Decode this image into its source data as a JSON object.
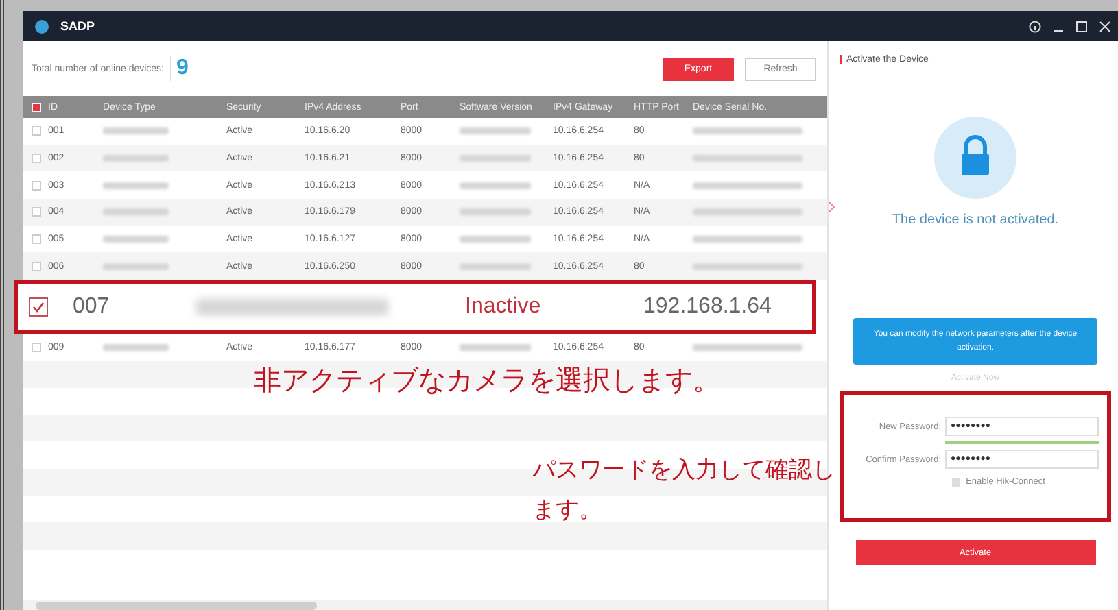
{
  "window": {
    "title": "SADP"
  },
  "summary": {
    "label": "Total number of online devices:",
    "count": "9"
  },
  "buttons": [
    {
      "label": "Export",
      "kind": "primary"
    },
    {
      "label": "Refresh",
      "kind": "secondary"
    }
  ],
  "table": {
    "header_checked": true,
    "columns": [
      "ID",
      "Device Type",
      "Security",
      "IPv4 Address",
      "Port",
      "Software Version",
      "IPv4 Gateway",
      "HTTP Port",
      "Device Serial No."
    ],
    "rows": [
      {
        "id": "001",
        "security": "Active",
        "ipv4": "10.16.6.20",
        "port": "8000",
        "gateway": "10.16.6.254",
        "http_port": "80",
        "checked": false
      },
      {
        "id": "002",
        "security": "Active",
        "ipv4": "10.16.6.21",
        "port": "8000",
        "gateway": "10.16.6.254",
        "http_port": "80",
        "checked": false
      },
      {
        "id": "003",
        "security": "Active",
        "ipv4": "10.16.6.213",
        "port": "8000",
        "gateway": "10.16.6.254",
        "http_port": "N/A",
        "checked": false
      },
      {
        "id": "004",
        "security": "Active",
        "ipv4": "10.16.6.179",
        "port": "8000",
        "gateway": "10.16.6.254",
        "http_port": "N/A",
        "checked": false
      },
      {
        "id": "005",
        "security": "Active",
        "ipv4": "10.16.6.127",
        "port": "8000",
        "gateway": "10.16.6.254",
        "http_port": "N/A",
        "checked": false
      },
      {
        "id": "006",
        "security": "Active",
        "ipv4": "10.16.6.250",
        "port": "8000",
        "gateway": "10.16.6.254",
        "http_port": "80",
        "checked": false
      }
    ],
    "rows_below": [
      {
        "id": "009",
        "security": "Active",
        "ipv4": "10.16.6.177",
        "port": "8000",
        "gateway": "10.16.6.254",
        "http_port": "80",
        "checked": false
      }
    ]
  },
  "highlight_row": {
    "id": "007",
    "security": "Inactive",
    "address": "192.168.1.64",
    "checked": true
  },
  "annotations": [
    {
      "lines": [
        "非アクティブなカメラを選択します。"
      ]
    },
    {
      "lines": [
        "パスワードを入力して確認し",
        "ます。"
      ]
    }
  ],
  "panel": {
    "heading": "Activate the Device",
    "status": "The device is not activated.",
    "tooltip": "You can modify the network parameters after the device activation.",
    "activate_now": "Activate Now",
    "new_password": {
      "label": "New Password:",
      "value": "●●●●●●●●"
    },
    "strength": {
      "level": 1
    },
    "confirm_password": {
      "label": "Confirm Password:",
      "value": "●●●●●●●●"
    },
    "hik_connect": {
      "label": "Enable Hik-Connect",
      "checked": false
    },
    "activate": "Activate"
  }
}
